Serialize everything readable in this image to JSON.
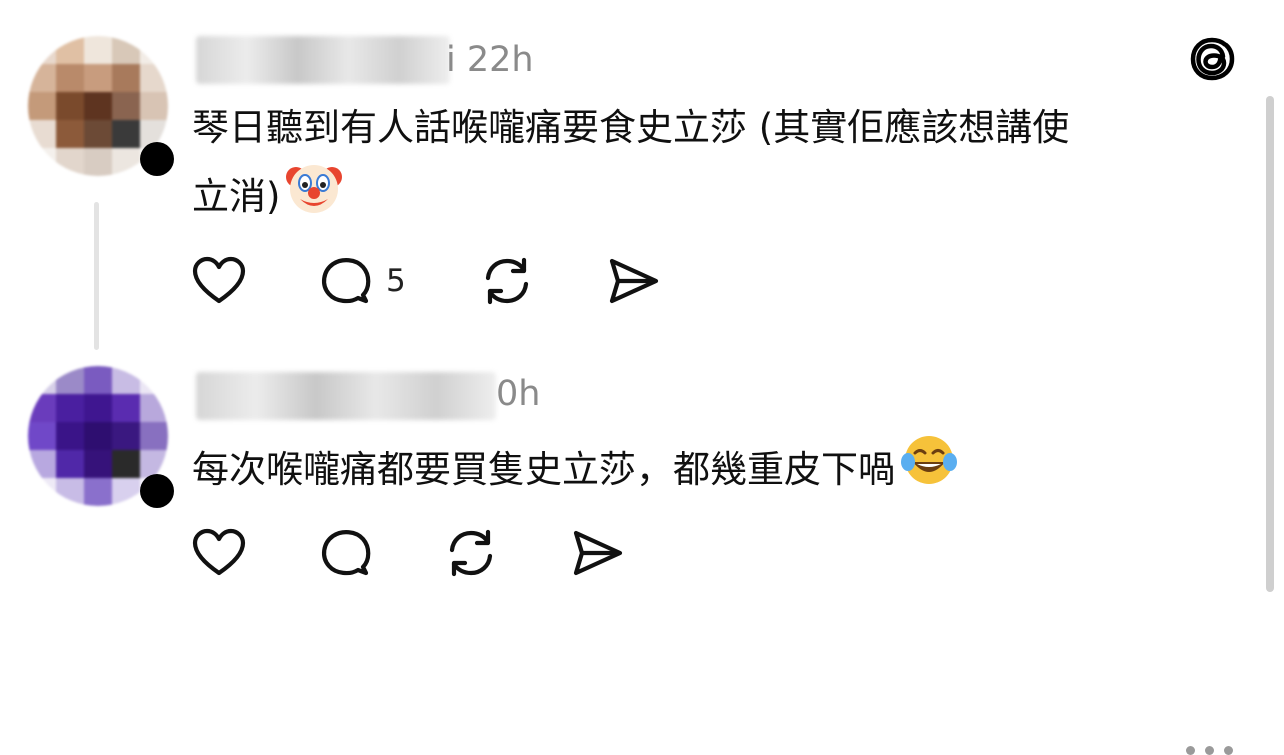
{
  "posts": [
    {
      "timestamp": "22h",
      "username_tail": "i",
      "text_line1": "琴日聽到有人話喉嚨痛要食史立莎 (其實佢應該想講使",
      "text_line2": "立消)",
      "emoji": "clown-face",
      "reply_count": "5",
      "header_icon": "threads-logo-icon"
    },
    {
      "timestamp": "0h",
      "text_line1": "每次喉嚨痛都要買隻史立莎，都幾重皮下喎",
      "emoji": "face-with-tears-of-joy",
      "reply_count": "",
      "header_icon": "more-options-icon"
    }
  ],
  "colors": {
    "text": "#101010",
    "muted": "#8a8a8a",
    "thread_line": "#e3e3e3"
  }
}
